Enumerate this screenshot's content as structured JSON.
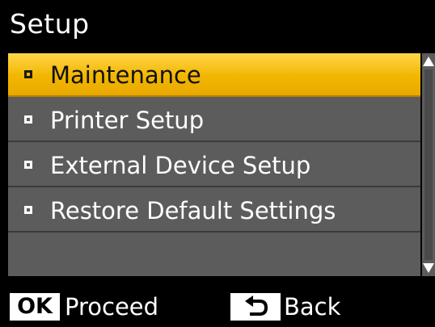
{
  "header": {
    "title": "Setup"
  },
  "menu": {
    "items": [
      {
        "label": "Maintenance",
        "selected": true
      },
      {
        "label": "Printer Setup",
        "selected": false
      },
      {
        "label": "External Device Setup",
        "selected": false
      },
      {
        "label": "Restore Default Settings",
        "selected": false
      }
    ]
  },
  "footer": {
    "ok_key": "OK",
    "ok_action": "Proceed",
    "back_icon": "back-arrow-icon",
    "back_action": "Back"
  },
  "colors": {
    "background": "#000000",
    "menu_bg": "#5c5c5c",
    "highlight": "#f2b600",
    "text": "#ffffff"
  }
}
